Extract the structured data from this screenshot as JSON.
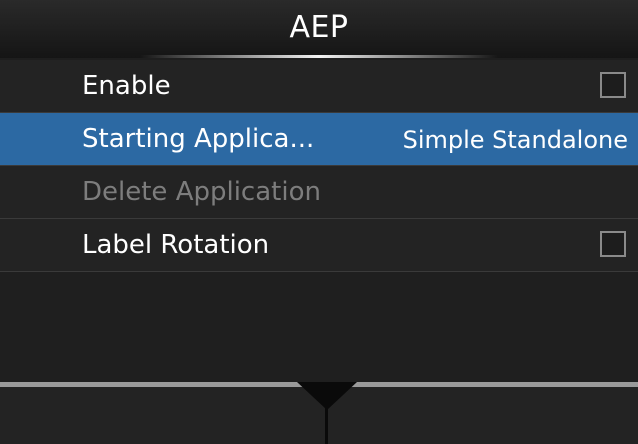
{
  "header": {
    "title": "AEP"
  },
  "menu": {
    "items": [
      {
        "label": "Enable",
        "control": "checkbox",
        "checked": false
      },
      {
        "label": "Starting Applica...",
        "value": "Simple Standalone",
        "selected": true
      },
      {
        "label": "Delete Application",
        "disabled": true
      },
      {
        "label": "Label Rotation",
        "control": "checkbox",
        "checked": false
      }
    ]
  },
  "colors": {
    "selected_row": "#2c69a3",
    "disabled_text": "#7d7d7d",
    "background": "#1e1e1e"
  }
}
